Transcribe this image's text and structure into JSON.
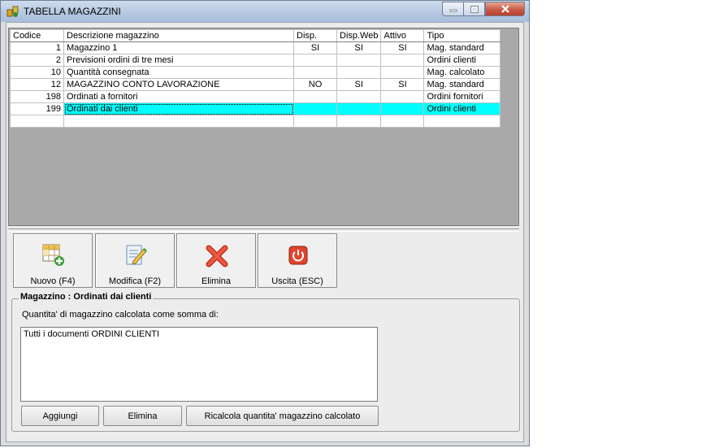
{
  "window": {
    "title": "TABELLA MAGAZZINI"
  },
  "table": {
    "headers": [
      "Codice",
      "Descrizione magazzino",
      "Disp.",
      "Disp.Web",
      "Attivo",
      "Tipo"
    ],
    "rows": [
      [
        "1",
        "Magazzino 1",
        "SI",
        "SI",
        "SI",
        "Mag. standard"
      ],
      [
        "2",
        "Previsioni ordini di tre mesi",
        "",
        "",
        "",
        "Ordini clienti"
      ],
      [
        "10",
        "Quantità consegnata",
        "",
        "",
        "",
        "Mag. calcolato"
      ],
      [
        "12",
        "MAGAZZINO CONTO LAVORAZIONE",
        "NO",
        "SI",
        "SI",
        "Mag. standard"
      ],
      [
        "198",
        "Ordinati a fornitori",
        "",
        "",
        "",
        "Ordini fornitori"
      ],
      [
        "199",
        "Ordinati dai clienti",
        "",
        "",
        "",
        "Ordini clienti"
      ],
      [
        "",
        "",
        "",
        "",
        "",
        ""
      ]
    ]
  },
  "toolbar": {
    "new_label": "Nuovo (F4)",
    "edit_label": "Modifica (F2)",
    "delete_label": "Elimina",
    "exit_label": "Uscita (ESC)"
  },
  "detail": {
    "group_title": "Magazzino : Ordinati dai clienti",
    "description": "Quantita' di magazzino calcolata come somma di:",
    "items": [
      "Tutti i documenti ORDINI CLIENTI"
    ],
    "add_label": "Aggiungi",
    "remove_label": "Elimina",
    "recalc_label": "Ricalcola quantita' magazzino calcolato"
  },
  "colors": {
    "selection": "#00ffff",
    "window_bg": "#ececec"
  }
}
